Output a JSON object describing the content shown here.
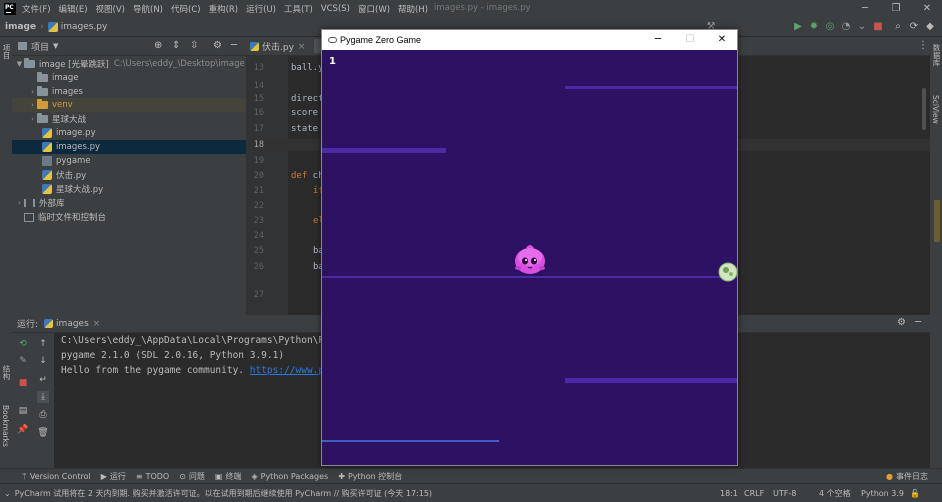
{
  "menubar": {
    "items": [
      "文件(F)",
      "编辑(E)",
      "视图(V)",
      "导航(N)",
      "代码(C)",
      "重构(R)",
      "运行(U)",
      "工具(T)",
      "VCS(S)",
      "窗口(W)",
      "帮助(H)"
    ],
    "doc_title": "images.py - images.py"
  },
  "navbar": {
    "project": "image",
    "file": "images.py",
    "run_config": "images"
  },
  "project_panel": {
    "title": "项目",
    "rows": [
      {
        "label": "image [光晕跳跃]",
        "path": "C:\\Users\\eddy_\\Desktop\\image"
      },
      {
        "label": "image"
      },
      {
        "label": "images"
      },
      {
        "label": "venv"
      },
      {
        "label": "星球大战"
      },
      {
        "label": "image.py"
      },
      {
        "label": "images.py"
      },
      {
        "label": "pygame"
      },
      {
        "label": "伏击.py"
      },
      {
        "label": "星球大战.py"
      },
      {
        "label": "外部库"
      },
      {
        "label": "临时文件和控制台"
      }
    ]
  },
  "editor": {
    "tab": "伏击.py",
    "line_numbers": [
      "13",
      "14",
      "15",
      "16",
      "17",
      "18",
      "19",
      "20",
      "21",
      "22",
      "23",
      "24",
      "25",
      "26",
      "27"
    ],
    "lines": {
      "l13": "ball.y",
      "l15": "direct",
      "l16": "score",
      "l17": "state",
      "l20_kw": "def",
      "l20": " ch",
      "l21_kw": "if",
      "l23_kw": "el",
      "l25": "ba",
      "l26": "ba"
    }
  },
  "run_panel": {
    "label": "运行:",
    "tab": "images",
    "output": [
      "C:\\Users\\eddy_\\AppData\\Local\\Programs\\Python\\Py",
      "pygame 2.1.0 (SDL 2.0.16, Python 3.9.1)",
      "Hello from the pygame community. "
    ],
    "output_link": "https://www.py"
  },
  "bottom_tools": [
    "Version Control",
    "运行",
    "TODO",
    "问题",
    "终端",
    "Python Packages",
    "Python 控制台",
    "事件日志"
  ],
  "statusbar": {
    "message": "PyCharm 试用将在 2 天内到期. 购买并激活许可证。以在试用到期后继续使用 PyCharm // 购买许可证 (今天 17:15)",
    "position": "18:1",
    "line_sep": "CRLF",
    "encoding": "UTF-8",
    "indent": "4 个空格",
    "interpreter": "Python 3.9"
  },
  "left_stripe": [
    "项目",
    "结构",
    "Bookmarks"
  ],
  "right_stripe": [
    "数据库",
    "SciView"
  ],
  "pygame_window": {
    "title": "Pygame Zero Game",
    "score": "1",
    "colors": {
      "background": "#2d1163",
      "platform": "#4a2aa6",
      "platform_light": "#3b5fc4"
    }
  }
}
